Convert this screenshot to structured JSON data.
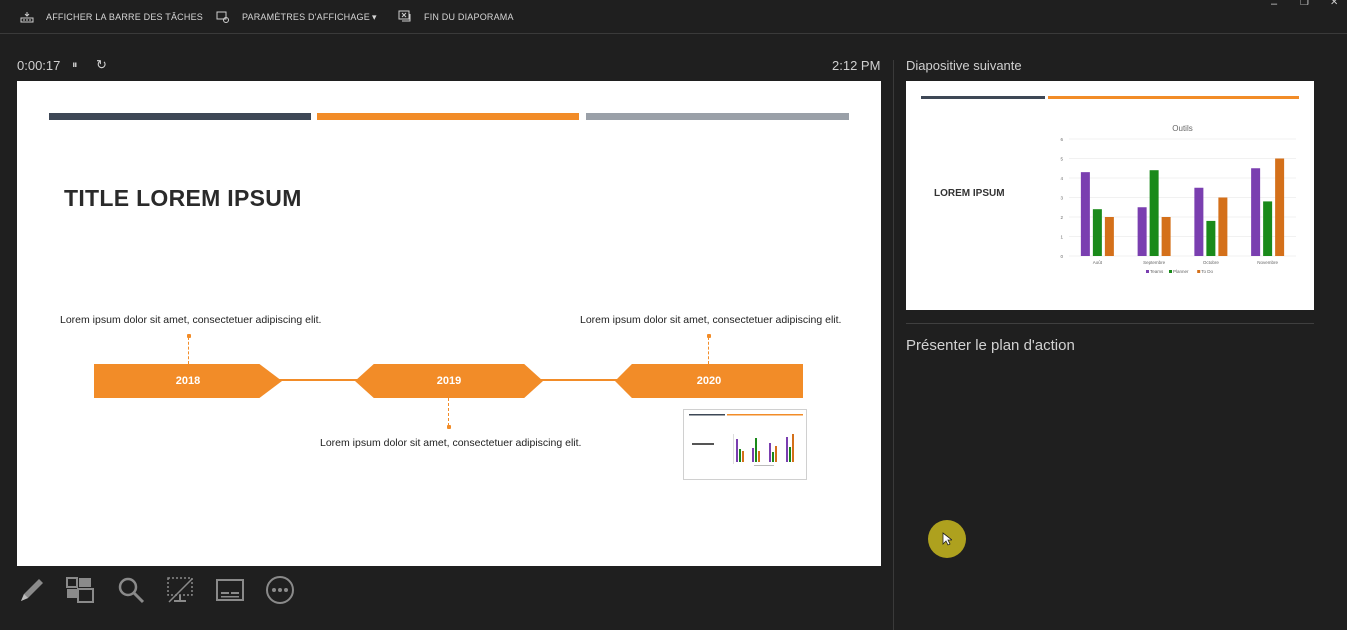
{
  "toolbar": {
    "taskbar_label": "AFFICHER LA BARRE DES TÂCHES",
    "display_settings_label": "PARAMÈTRES D'AFFICHAGE",
    "display_settings_caret": "▾",
    "end_show_label": "FIN DU DIAPORAMA"
  },
  "window": {
    "minimize": "–",
    "restore": "❐",
    "close": "✕"
  },
  "presenter": {
    "elapsed": "0:00:17",
    "pause_icon": "⏸",
    "reset_icon": "↻",
    "clock": "2:12 PM",
    "next_label": "Diapositive suivante",
    "notes": "Présenter le plan d'action"
  },
  "slide": {
    "title": "TITLE LOREM IPSUM",
    "bar_colors": [
      "#3e4856",
      "#f28c28",
      "#9aa0a8"
    ],
    "accent": "#f28c28",
    "timeline": [
      {
        "year": "2018",
        "text": "Lorem ipsum dolor sit amet, consectetuer adipiscing elit."
      },
      {
        "year": "2019",
        "text": "Lorem ipsum dolor sit amet, consectetuer adipiscing elit."
      },
      {
        "year": "2020",
        "text": "Lorem ipsum dolor sit amet, consectetuer adipiscing elit."
      }
    ]
  },
  "next_slide": {
    "title": "LOREM IPSUM",
    "chart_data": {
      "type": "bar",
      "title": "Outils",
      "categories": [
        "Août",
        "Septembre",
        "Octobre",
        "Novembre"
      ],
      "series": [
        {
          "name": "Teams",
          "color": "#7a3fb0",
          "values": [
            4.3,
            2.5,
            3.5,
            4.5
          ]
        },
        {
          "name": "Planner",
          "color": "#1a8a1a",
          "values": [
            2.4,
            4.4,
            1.8,
            2.8
          ]
        },
        {
          "name": "To Do",
          "color": "#d4701a",
          "values": [
            2.0,
            2.0,
            3.0,
            5.0
          ]
        }
      ],
      "ylim": [
        0,
        6
      ],
      "yticks": [
        "0",
        "1",
        "2",
        "3",
        "4",
        "5",
        "6"
      ],
      "grid": true,
      "legend": "bottom"
    }
  },
  "tools": [
    "pen-icon",
    "slides-grid-icon",
    "zoom-icon",
    "screen-icon",
    "subtitles-icon",
    "more-icon"
  ]
}
